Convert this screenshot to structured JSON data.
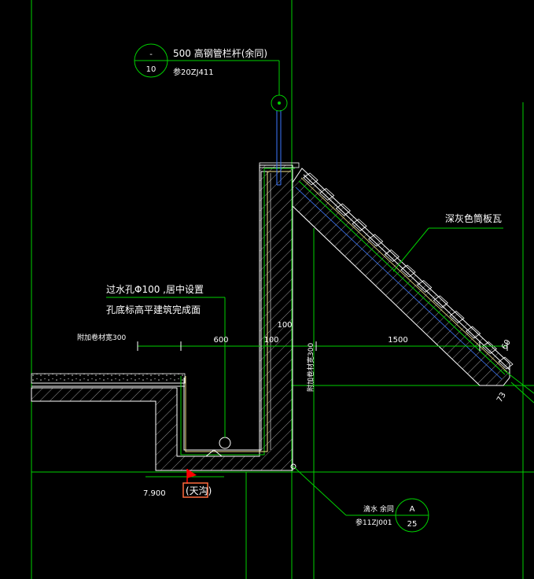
{
  "colors": {
    "background": "#000000",
    "line_green": "#00d000",
    "line_white": "#ffffff",
    "line_blue": "#3c78ff",
    "marker_red": "#ff0000",
    "highlight_orange": "#ff6a3d",
    "hatch": "#cfcfcf"
  },
  "railing_callout": {
    "bubble_top": "-",
    "bubble_bottom": "10",
    "text": "500 高钢管栏杆(余同)",
    "ref": "参20ZJ411"
  },
  "tile_label": "深灰色筒板瓦",
  "hole_note": {
    "line1": "过水孔Φ100 ,居中设置",
    "line2": "孔底标高平建筑完成面"
  },
  "dimensions": {
    "left_note": "附加卷材宽300",
    "d600": "600",
    "d100_h": "100",
    "d100_v": "100",
    "vertical_note": "附加卷材宽300",
    "d1500": "1500",
    "d60": "60",
    "d73": "73"
  },
  "elevation": {
    "value": "7.900",
    "tag": "(天沟)"
  },
  "drip_callout": {
    "text": "滴水 余同",
    "ref": "参11ZJ001",
    "bubble_top": "A",
    "bubble_bottom": "25"
  }
}
